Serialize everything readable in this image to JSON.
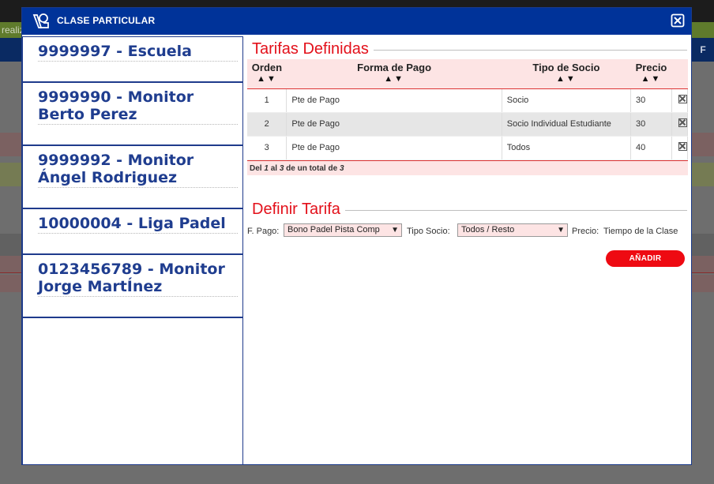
{
  "background": {
    "green_bar_text": "realiz",
    "nav_tail_text": "F"
  },
  "modal": {
    "title": "CLASE PARTICULAR",
    "logo_icon": "lesson-icon",
    "close_icon": "close-icon"
  },
  "sidebar": {
    "items": [
      {
        "label": "9999997 - Escuela"
      },
      {
        "label": "9999990 - Monitor Berto Perez"
      },
      {
        "label": "9999992 - Monitor Ángel Rodriguez"
      },
      {
        "label": "10000004 - Liga Padel"
      },
      {
        "label": "0123456789 - Monitor Jorge MartÍnez"
      }
    ]
  },
  "tarifas": {
    "title": "Tarifas Definidas",
    "columns": {
      "orden": "Orden",
      "forma_pago": "Forma de Pago",
      "tipo_socio": "Tipo de Socio",
      "precio": "Precio"
    },
    "sort_arrows": "▲▼",
    "rows": [
      {
        "orden": "1",
        "forma_pago": "Pte de Pago",
        "tipo_socio": "Socio",
        "precio": "30"
      },
      {
        "orden": "2",
        "forma_pago": "Pte de Pago",
        "tipo_socio": "Socio Individual Estudiante",
        "precio": "30"
      },
      {
        "orden": "3",
        "forma_pago": "Pte de Pago",
        "tipo_socio": "Todos",
        "precio": "40"
      }
    ],
    "pager": {
      "del": "Del",
      "from": "1",
      "al": "al",
      "to": "3",
      "de_un_total_de": "de un total de",
      "total": "3"
    }
  },
  "definir": {
    "title": "Definir Tarifa",
    "f_pago_label": "F. Pago:",
    "f_pago_value": "Bono Padel Pista Comp",
    "tipo_socio_label": "Tipo  Socio:",
    "tipo_socio_value": "Todos / Resto",
    "precio_label": "Precio:",
    "precio_value": "Tiempo de la Clase",
    "caret": "▼",
    "add_button": "AÑADIR"
  },
  "colors": {
    "header_blue": "#003399",
    "accent_red": "#ee0a12",
    "pink_bg": "#fde4e4",
    "sidebar_text": "#1f3d8f"
  }
}
